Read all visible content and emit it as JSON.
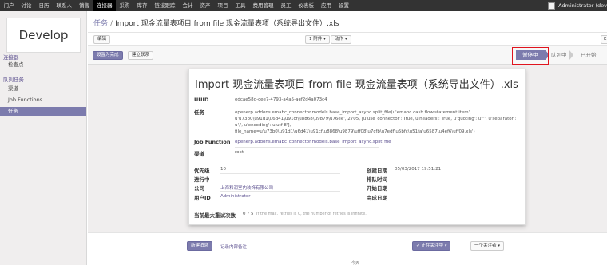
{
  "topbar": {
    "menu": [
      "门户",
      "讨论",
      "日历",
      "联系人",
      "销售",
      "连接器",
      "采购",
      "库存",
      "链接跟踪",
      "会计",
      "资产",
      "项目",
      "工具",
      "费用管理",
      "员工",
      "仪表板",
      "应用",
      "设置"
    ],
    "active_menu": "连接器",
    "user": "Administrator (dev"
  },
  "sidebar": {
    "logo": "Develop",
    "sections": [
      {
        "title": "连接器",
        "items": [
          "检查点"
        ]
      },
      {
        "title": "队列任务",
        "items": [
          "渠道",
          "Job Functions",
          "任务"
        ]
      }
    ],
    "active_item": "任务"
  },
  "breadcrumb": {
    "root": "任务",
    "separator": "/",
    "title": "Import 现金流量表项目 from file 现金流量表项（系统导出文件）.xls"
  },
  "controls": {
    "edit": "编辑",
    "attachments": "1 附件",
    "actions": "动作",
    "pager_btn": "E"
  },
  "statusbar": {
    "set_done": "设置为完成",
    "link": "建立联系",
    "stages": [
      {
        "label": "暂停中",
        "active": true
      },
      {
        "label": "队列中",
        "active": false
      },
      {
        "label": "已开始",
        "active": false
      }
    ]
  },
  "sheet": {
    "title": "Import 现金流量表项目 from file 现金流量表项（系统导出文件）.xls",
    "uuid_label": "UUID",
    "uuid": "edcae58d-cee7-4793-a4a5-aef2d4a073c4",
    "task_label": "任务",
    "task_lines": [
      "openerp.addons.emabc_connector.models.base_import_async.split_file(u'emabc.cash.flow.statement.item',",
      "u'u73b0\\u91d1\\u6d41\\u91cf\\u8868\\u9879\\u76ee', 2705, [u'use_connector': True, u'headers': True, u'quoting': u'\"', u'separator':",
      "u',', u'encoding': u'utf-8'],",
      "file_name=u'u73b0\\u91d1\\u6d41\\u91cf\\u8868\\u9879\\uff08\\u7cfb\\u7edf\\u5bfc\\u51fa\\u6587\\u4ef6\\uff09.xls')"
    ],
    "job_function_label": "Job Function",
    "job_function": "openerp.addons.emabc_connector.models.base_import_async.split_file",
    "channel_label": "渠道",
    "channel": "root",
    "priority_label": "优先级",
    "priority": "10",
    "worker_label": "进行中",
    "company_label": "公司",
    "company": "上海和润室内装饰有限公司",
    "user_label": "用户ID",
    "user": "Administrator",
    "create_label": "创建日期",
    "create_date": "05/03/2017 19:51:21",
    "eta_label": "排队时间",
    "start_label": "开始日期",
    "done_label": "完成日期",
    "retry_label": "当前最大重试次数",
    "retry_value": "0",
    "retry_sep": "/",
    "retry_max": "5",
    "retry_hint": "If the max. retries is 0, the number of retries is infinite."
  },
  "chatter": {
    "new_message": "新建消息",
    "log_note": "记录内部备注",
    "following": "✓ 正在关注中",
    "followers": "一个关注者",
    "today": "今天"
  }
}
